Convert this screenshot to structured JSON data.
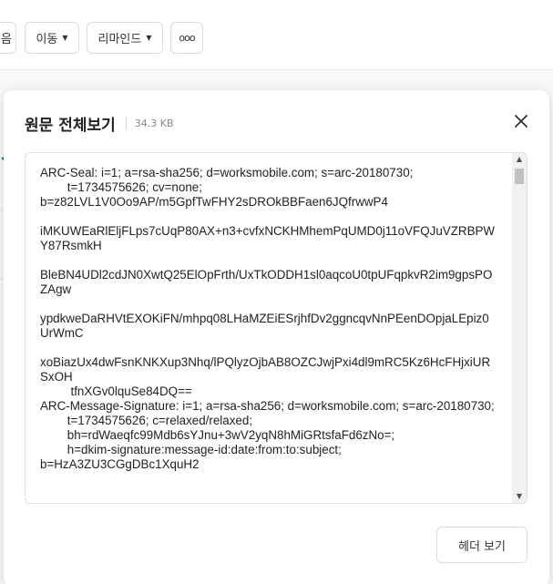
{
  "toolbar": {
    "partial_label": "음",
    "move_label": "이동",
    "remind_label": "리마인드",
    "more_label": "ooo"
  },
  "modal": {
    "title": "원문 전체보기",
    "file_size": "34.3 KB",
    "source_text": "ARC-Seal: i=1; a=rsa-sha256; d=worksmobile.com; s=arc-20180730;\n        t=1734575626; cv=none;\nb=z82LVL1V0Oo9AP/m5GpfTwFHY2sDROkBBFaen6JQfrwwP4\n\niMKUWEaRlEljFLps7cUqP80AX+n3+cvfxNCKHMhemPqUMD0j11oVFQJuVZRBPWY87RsmkH\n\nBleBN4UDl2cdJN0XwtQ25ElOpFrth/UxTkODDH1sl0aqcoU0tpUFqpkvR2im9gpsPOZAgw\n\nypdkweDaRHVtEXOKiFN/mhpq08LHaMZEiESrjhfDv2ggncqvNnPEenDOpjaLEpiz0UrWmC\n\nxoBiazUx4dwFsnKNKXup3Nhq/lPQlyzOjbAB8OZCJwjPxi4dl9mRC5Kz6HcFHjxiURSxOH\n         tfnXGv0lquSe84DQ==\nARC-Message-Signature: i=1; a=rsa-sha256; d=worksmobile.com; s=arc-20180730;\n        t=1734575626; c=relaxed/relaxed;\n        bh=rdWaeqfc99Mdb6sYJnu+3wV2yqN8hMiGRtsfaFd6zNo=;\n        h=dkim-signature:message-id:date:from:to:subject;\nb=HzA3ZU3CGgDBc1XquH2",
    "header_button_label": "헤더 보기"
  },
  "icons": {
    "close": "close-icon",
    "caret": "caret-down-icon"
  },
  "colors": {
    "accent": "#1a73e8",
    "border": "#d9dbe0",
    "muted": "#888888"
  }
}
